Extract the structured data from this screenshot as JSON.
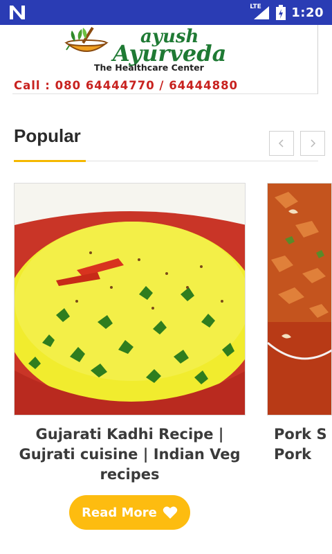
{
  "status_bar": {
    "time": "1:20",
    "network_label": "LTE",
    "icons": [
      "n-notification-icon",
      "lte-signal-icon",
      "battery-icon"
    ],
    "color": "#2a3cb4"
  },
  "banner": {
    "brand_line1": "ayush",
    "brand_line2": "Ayurveda",
    "subtitle": "The Healthcare Center",
    "phone": "Call : 080 64444770 / 64444880",
    "logo_icon": "mortar-and-herbs-icon"
  },
  "section": {
    "title": "Popular",
    "prev_icon": "chevron-left-icon",
    "next_icon": "chevron-right-icon",
    "accent_color": "#f5b800"
  },
  "cards": [
    {
      "title": "Gujarati Kadhi Recipe | Gujrati cuisine | Indian Veg recipes",
      "image": "kadhi-dish-photo",
      "button_label": "Read More",
      "button_icon": "heart-icon",
      "button_color": "#fdbc10"
    },
    {
      "title": "Pork S\nPork",
      "image": "pork-dish-photo"
    }
  ]
}
